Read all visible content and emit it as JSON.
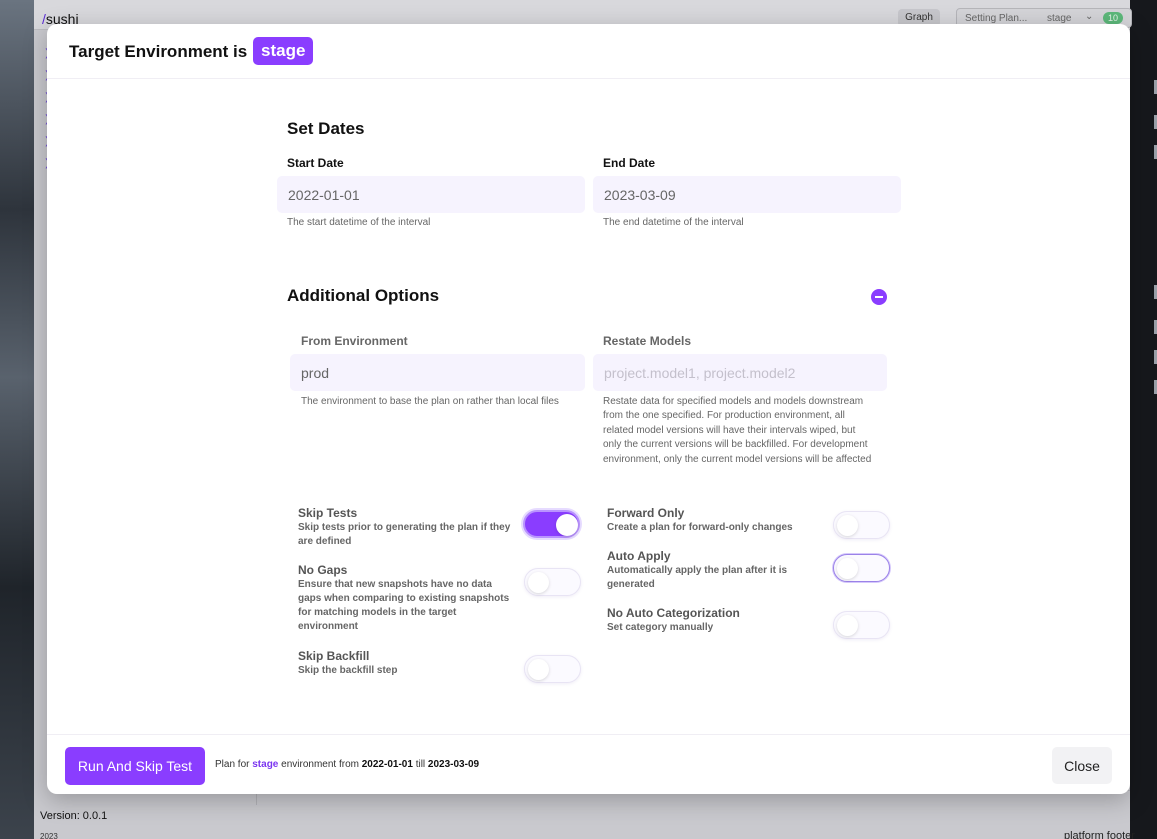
{
  "background_app": {
    "title_slash": "/",
    "title": "sushi",
    "graph_label": "Graph",
    "plan_status": "Setting Plan...",
    "env_select": "stage",
    "count_badge": "10",
    "version": "Version: 0.0.1",
    "footer_year": "2023",
    "footer_label": "platform footer"
  },
  "modal": {
    "title": "Target Environment is",
    "env_badge": "stage",
    "set_dates": {
      "title": "Set Dates",
      "start_label": "Start Date",
      "start_value": "2022-01-01",
      "start_help": "The start datetime of the interval",
      "end_label": "End Date",
      "end_value": "2023-03-09",
      "end_help": "The end datetime of the interval"
    },
    "additional": {
      "title": "Additional Options",
      "from_env_label": "From Environment",
      "from_env_value": "prod",
      "from_env_help": "The environment to base the plan on rather than local files",
      "restate_label": "Restate Models",
      "restate_placeholder": "project.model1, project.model2",
      "restate_help": "Restate data for specified models and models downstream from the one specified. For production environment, all related model versions will have their intervals wiped, but only the current versions will be backfilled. For development environment, only the current model versions will be affected"
    },
    "options": [
      {
        "title": "Skip Tests",
        "desc": "Skip tests prior to generating the plan if they are defined",
        "on": true
      },
      {
        "title": "No Gaps",
        "desc": "Ensure that new snapshots have no data gaps when comparing to existing snapshots for matching models in the target environment",
        "on": false
      },
      {
        "title": "Skip Backfill",
        "desc": "Skip the backfill step",
        "on": false
      },
      {
        "title": "Forward Only",
        "desc": "Create a plan for forward-only changes",
        "on": false
      },
      {
        "title": "Auto Apply",
        "desc": "Automatically apply the plan after it is generated",
        "on": false
      },
      {
        "title": "No Auto Categorization",
        "desc": "Set category manually",
        "on": false
      }
    ],
    "footer": {
      "run_label": "Run And Skip Test",
      "summary_prefix": "Plan for",
      "summary_env": "stage",
      "summary_mid": "environment from",
      "summary_start": "2022-01-01",
      "summary_till": "till",
      "summary_end": "2023-03-09",
      "close_label": "Close"
    }
  },
  "colors": {
    "accent": "#8a3dff",
    "accent_text": "#7b35f0",
    "input_bg": "#f6f3fe",
    "success": "#5cb87a"
  }
}
